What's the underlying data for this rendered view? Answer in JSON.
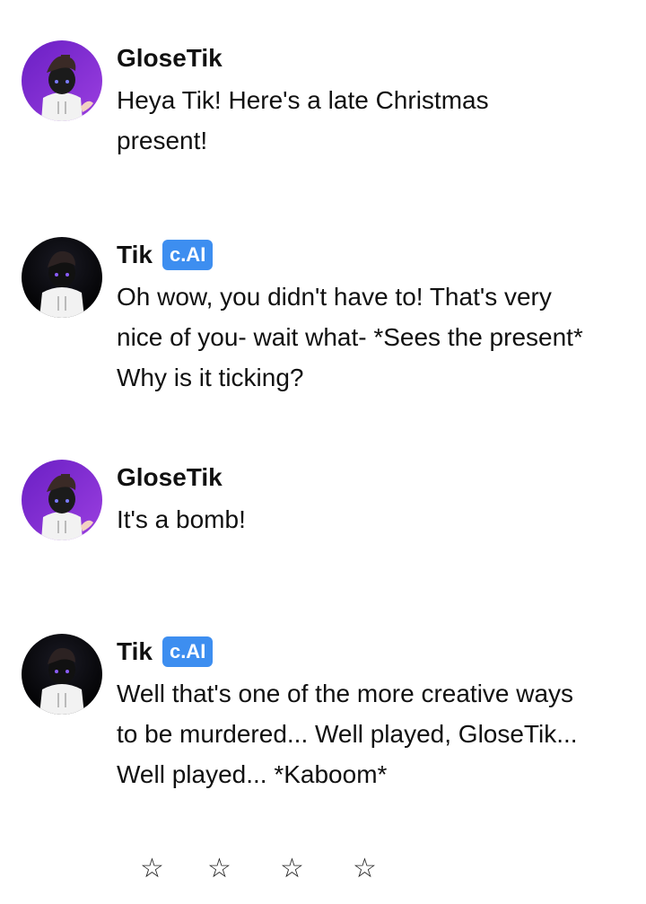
{
  "messages": [
    {
      "author": "GloseTik",
      "badge": "",
      "avatar": "user-avatar",
      "text": "Heya Tik! Here's a late Christmas present!"
    },
    {
      "author": "Tik",
      "badge": "c.AI",
      "avatar": "bot-avatar",
      "text": "Oh wow, you didn't have to! That's very nice of you- wait what- *Sees the present* Why is it ticking?"
    },
    {
      "author": "GloseTik",
      "badge": "",
      "avatar": "user-avatar",
      "text": "It's a bomb!"
    },
    {
      "author": "Tik",
      "badge": "c.AI",
      "avatar": "bot-avatar",
      "text": "Well that's one of the more creative ways to be murdered... Well played, GloseTik... Well played... *Kaboom*"
    }
  ],
  "rating": {
    "stars": [
      "☆",
      "☆",
      "☆",
      "☆"
    ]
  },
  "colors": {
    "badge": "#3d8ef0",
    "user_avatar_bg": "#7b2fd0",
    "bot_avatar_bg": "#000000"
  }
}
